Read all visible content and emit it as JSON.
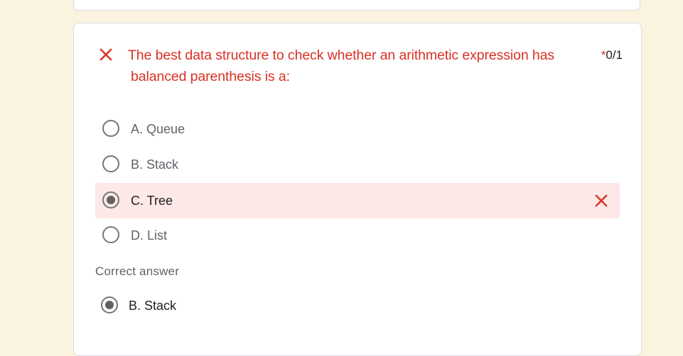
{
  "question": {
    "title_line1": "The best data structure to check whether an arithmetic expression has",
    "title_line2": "balanced parenthesis is  a:",
    "required_marker": "*",
    "score": "0/1",
    "status_icon": "close-icon",
    "status_color": "#d93025"
  },
  "options": [
    {
      "label": "A. Queue",
      "selected": false
    },
    {
      "label": "B. Stack",
      "selected": false
    },
    {
      "label": "C. Tree",
      "selected": true,
      "incorrect": true
    },
    {
      "label": "D. List",
      "selected": false
    }
  ],
  "correct_answer": {
    "heading": "Correct answer",
    "label": "B. Stack"
  },
  "colors": {
    "page_background": "#faf3df",
    "card_background": "#ffffff",
    "error_red": "#d93025",
    "wrong_highlight": "#fce8e6"
  }
}
